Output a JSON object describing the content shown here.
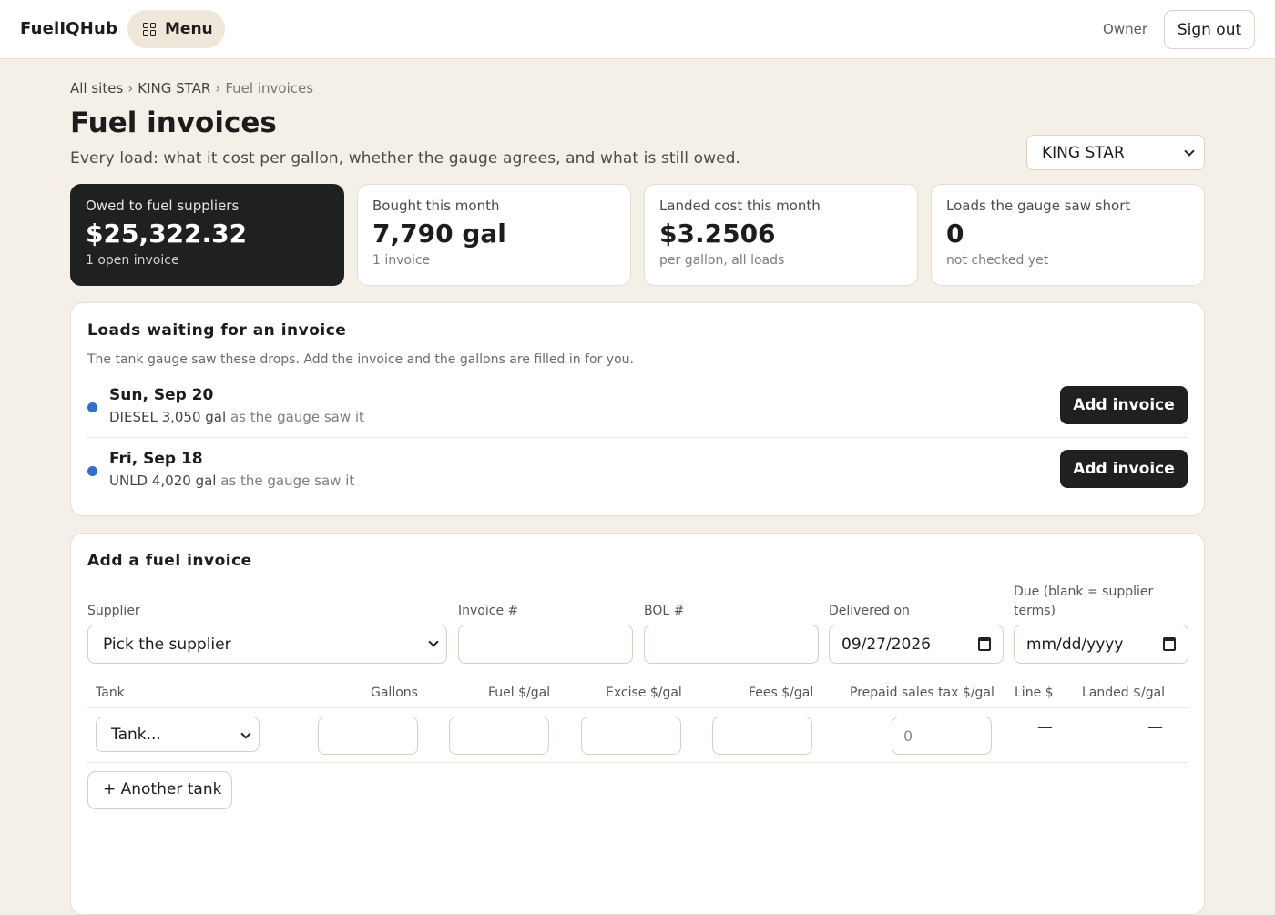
{
  "app": {
    "brand": "FuelIQHub",
    "menu_label": "Menu",
    "role": "Owner",
    "signout_label": "Sign out"
  },
  "breadcrumb": {
    "items": [
      "All sites",
      "KING STAR",
      "Fuel invoices"
    ],
    "separator": "›"
  },
  "page": {
    "title": "Fuel invoices",
    "subtitle": "Every load: what it cost per gallon, whether the gauge agrees, and what is still owed.",
    "site_selected": "KING STAR"
  },
  "stats": [
    {
      "label": "Owed to fuel suppliers",
      "value": "$25,322.32",
      "sub": "1 open invoice",
      "highlight": true
    },
    {
      "label": "Bought this month",
      "value": "7,790 gal",
      "sub": "1 invoice"
    },
    {
      "label": "Landed cost this month",
      "value": "$3.2506",
      "sub": "per gallon, all loads"
    },
    {
      "label": "Loads the gauge saw short",
      "value": "0",
      "sub": "not checked yet"
    }
  ],
  "pending": {
    "title": "Loads waiting for an invoice",
    "note": "The tank gauge saw these drops. Add the invoice and the gallons are filled in for you.",
    "loads": [
      {
        "date": "Sun, Sep 20",
        "product_gal": "DIESEL 3,050 gal",
        "suffix": "as the gauge saw it",
        "action": "Add invoice"
      },
      {
        "date": "Fri, Sep 18",
        "product_gal": "UNLD 4,020 gal",
        "suffix": "as the gauge saw it",
        "action": "Add invoice"
      }
    ]
  },
  "form": {
    "title": "Add a fuel invoice",
    "supplier_label": "Supplier",
    "supplier_placeholder": "Pick the supplier",
    "invoice_label": "Invoice #",
    "bol_label": "BOL #",
    "delivered_label": "Delivered on",
    "delivered_value": "09/27/2026",
    "due_label_line1": "Due (blank = supplier",
    "due_label_line2": "terms)",
    "due_placeholder": "mm/dd/yyyy",
    "columns": [
      "Tank",
      "Gallons",
      "Fuel $/gal",
      "Excise $/gal",
      "Fees $/gal",
      "Prepaid sales tax $/gal",
      "Line $",
      "Landed $/gal"
    ],
    "tank_placeholder": "Tank...",
    "prepaid_value": "0",
    "line_value": "—",
    "landed_value": "—",
    "another_tank": "+ Another tank"
  },
  "colors": {
    "accent_dot": "#2f6fd0",
    "dark_button": "#1f2020",
    "page_bg": "#f4f0e8"
  }
}
